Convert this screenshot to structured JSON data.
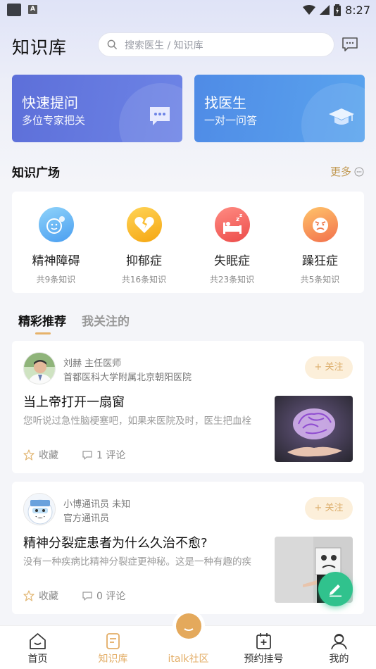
{
  "status_bar": {
    "time": "8:27"
  },
  "header": {
    "title": "知识库",
    "search_placeholder": "搜索医生 / 知识库"
  },
  "quick_cards": [
    {
      "title": "快速提问",
      "subtitle": "多位专家把关"
    },
    {
      "title": "找医生",
      "subtitle": "一对一问答"
    }
  ],
  "section": {
    "title": "知识广场",
    "more_label": "更多"
  },
  "categories": [
    {
      "name": "精神障碍",
      "count": "共9条知识"
    },
    {
      "name": "抑郁症",
      "count": "共16条知识"
    },
    {
      "name": "失眠症",
      "count": "共23条知识"
    },
    {
      "name": "躁狂症",
      "count": "共5条知识"
    }
  ],
  "feed_tabs": [
    "精彩推荐",
    "我关注的"
  ],
  "posts": [
    {
      "author": "刘赫 主任医师",
      "org": "首都医科大学附属北京朝阳医院",
      "follow_label": "+ 关注",
      "title": "当上帝打开一扇窗",
      "snippet": "您听说过急性脑梗塞吧，如果来医院及时，医生把血栓",
      "fav_label": "收藏",
      "comment_label": "1 评论"
    },
    {
      "author": "小博通讯员 未知",
      "org": "官方通讯员",
      "follow_label": "+ 关注",
      "title": "精神分裂症患者为什么久治不愈?",
      "snippet": "没有一种疾病比精神分裂症更神秘。这是一种有趣的疾",
      "fav_label": "收藏",
      "comment_label": "0 评论"
    }
  ],
  "bottom_nav": [
    {
      "label": "首页"
    },
    {
      "label": "知识库"
    },
    {
      "label": "italk社区"
    },
    {
      "label": "预约挂号"
    },
    {
      "label": "我的"
    }
  ],
  "colors": {
    "accent": "#e3ad66",
    "card_left": "#5d6fd9",
    "card_right": "#4f8be6",
    "fab": "#30c28d"
  }
}
